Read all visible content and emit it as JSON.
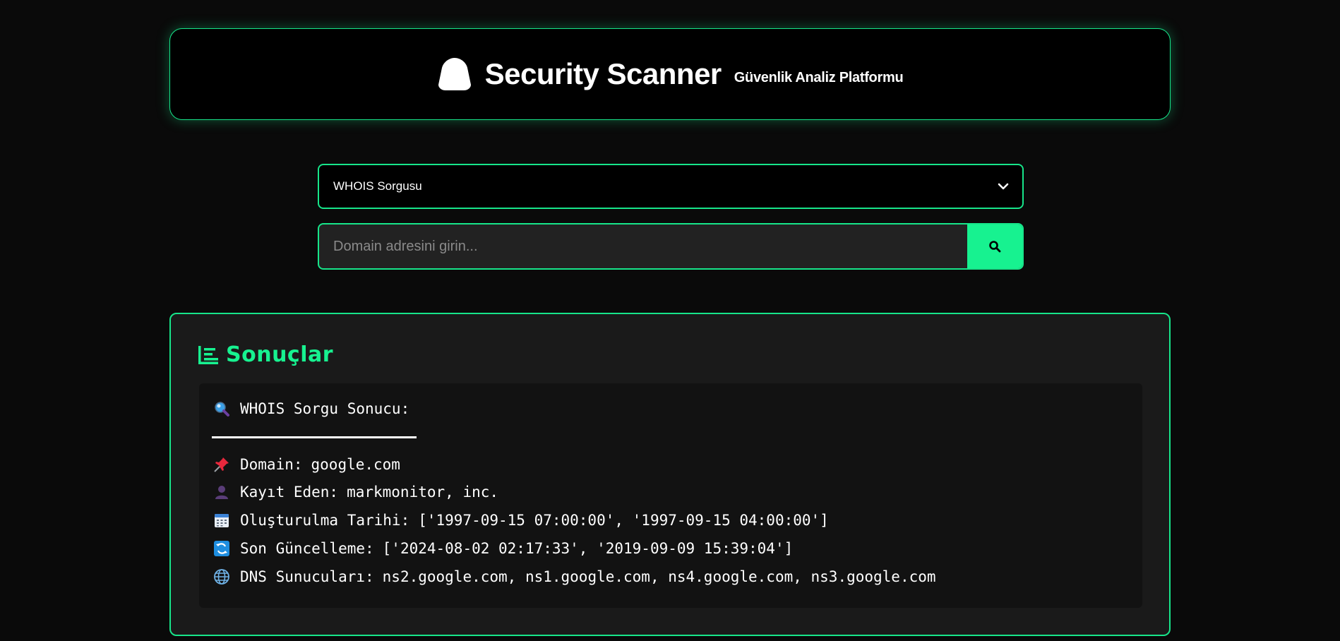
{
  "header": {
    "title": "Security Scanner",
    "subtitle": "Güvenlik Analiz Platformu",
    "logo_icon": "shield-icon"
  },
  "query_select": {
    "selected": "WHOIS Sorgusu",
    "icon": "chevron-down-icon"
  },
  "search": {
    "placeholder": "Domain adresini girin...",
    "value": "",
    "button_icon": "search-icon"
  },
  "results": {
    "title": "Sonuçlar",
    "title_icon": "list-icon",
    "heading": "WHOIS Sorgu Sonucu:",
    "heading_icon": "magnifier-icon",
    "lines": [
      {
        "icon": "pushpin-icon",
        "label": "Domain:",
        "value": "google.com"
      },
      {
        "icon": "person-icon",
        "label": "Kayıt Eden:",
        "value": "markmonitor, inc."
      },
      {
        "icon": "calendar-icon",
        "label": "Oluşturulma Tarihi:",
        "value": "['1997-09-15 07:00:00', '1997-09-15 04:00:00']"
      },
      {
        "icon": "refresh-icon",
        "label": "Son Güncelleme:",
        "value": "['2024-08-02 02:17:33', '2019-09-09 15:39:04']"
      },
      {
        "icon": "globe-icon",
        "label": "DNS Sunucuları:",
        "value": "ns2.google.com, ns1.google.com, ns4.google.com, ns3.google.com"
      }
    ]
  },
  "colors": {
    "accent": "#17f290",
    "border": "#17e58a",
    "background": "#0a0a0a",
    "card": "#1a1a1a",
    "panel": "#121212"
  }
}
